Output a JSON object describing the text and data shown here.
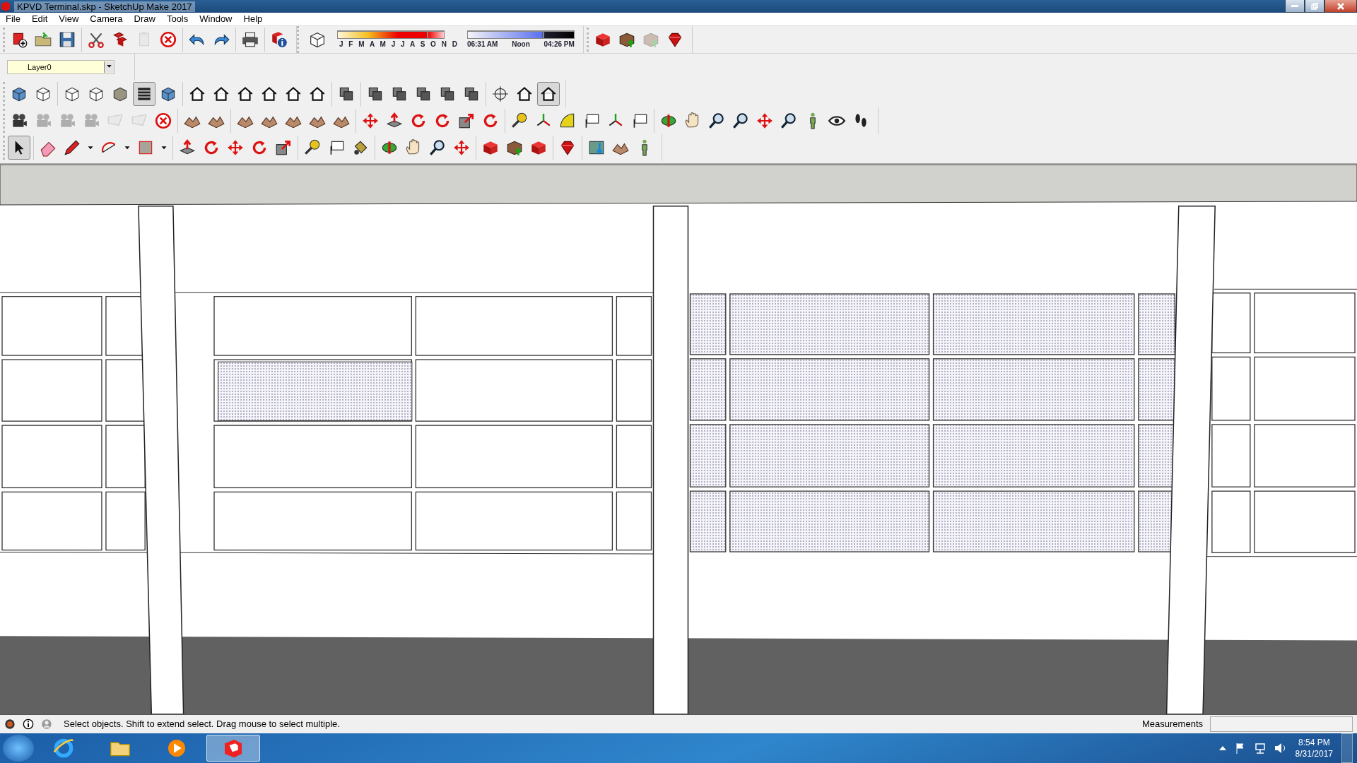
{
  "window": {
    "title": "KPVD Terminal.skp - SketchUp Make 2017"
  },
  "menu": [
    "File",
    "Edit",
    "View",
    "Camera",
    "Draw",
    "Tools",
    "Window",
    "Help"
  ],
  "standard_toolbar": [
    [
      {
        "kind": "new",
        "selected": false,
        "disabled": false
      },
      {
        "kind": "open",
        "selected": false,
        "disabled": false
      },
      {
        "kind": "save",
        "selected": false,
        "disabled": false
      }
    ],
    [
      {
        "kind": "cut",
        "selected": false,
        "disabled": false
      },
      {
        "kind": "copy",
        "selected": false,
        "disabled": false
      },
      {
        "kind": "paste",
        "selected": false,
        "disabled": true
      },
      {
        "kind": "delete",
        "selected": false,
        "disabled": false
      }
    ],
    [
      {
        "kind": "undo",
        "selected": false,
        "disabled": false
      },
      {
        "kind": "redo",
        "selected": false,
        "disabled": false
      }
    ],
    [
      {
        "kind": "print",
        "selected": false,
        "disabled": false
      }
    ],
    [
      {
        "kind": "info",
        "selected": false,
        "disabled": false
      }
    ]
  ],
  "shadow_settings": {
    "months": "J F M A M J J A S O N D",
    "date_slider": {
      "level": 0.85
    },
    "time_slider": {
      "level": 0.72
    },
    "start_time": "06:31 AM",
    "noon": "Noon",
    "end_time": "04:26 PM"
  },
  "warehouse_toolbar": [
    [
      {
        "kind": "warehouse",
        "selected": false,
        "disabled": false
      },
      {
        "kind": "share",
        "selected": false,
        "disabled": false
      },
      {
        "kind": "share",
        "selected": false,
        "disabled": true
      },
      {
        "kind": "gem",
        "selected": false,
        "disabled": false
      }
    ]
  ],
  "layer": {
    "value": "Layer0"
  },
  "toolbar_rows": [
    [
      [
        {
          "kind": "cube",
          "selected": false,
          "disabled": false
        },
        {
          "kind": "cube-outline",
          "selected": false,
          "disabled": false
        }
      ],
      [
        {
          "kind": "cube-outline",
          "selected": false,
          "disabled": false
        },
        {
          "kind": "cube-outline",
          "selected": false,
          "disabled": false
        },
        {
          "kind": "cube-gray",
          "selected": false,
          "disabled": false
        },
        {
          "kind": "stripes",
          "selected": true,
          "disabled": false
        },
        {
          "kind": "cube",
          "selected": false,
          "disabled": false
        }
      ],
      [
        {
          "kind": "house",
          "selected": false,
          "disabled": false
        },
        {
          "kind": "house",
          "selected": false,
          "disabled": false
        },
        {
          "kind": "house",
          "selected": false,
          "disabled": false
        },
        {
          "kind": "house",
          "selected": false,
          "disabled": false
        },
        {
          "kind": "house",
          "selected": false,
          "disabled": false
        },
        {
          "kind": "house",
          "selected": false,
          "disabled": false
        }
      ],
      [
        {
          "kind": "boxes",
          "selected": false,
          "disabled": false
        }
      ],
      [
        {
          "kind": "boxes",
          "selected": false,
          "disabled": false
        },
        {
          "kind": "boxes",
          "selected": false,
          "disabled": false
        },
        {
          "kind": "boxes",
          "selected": false,
          "disabled": false
        },
        {
          "kind": "boxes",
          "selected": false,
          "disabled": false
        },
        {
          "kind": "boxes",
          "selected": false,
          "disabled": false
        }
      ],
      [
        {
          "kind": "compass",
          "selected": false,
          "disabled": false
        },
        {
          "kind": "house",
          "selected": false,
          "disabled": false
        },
        {
          "kind": "house",
          "selected": true,
          "disabled": false
        }
      ]
    ],
    [
      [
        {
          "kind": "camera",
          "selected": false,
          "disabled": false
        },
        {
          "kind": "camera",
          "selected": false,
          "disabled": true
        },
        {
          "kind": "camera",
          "selected": false,
          "disabled": true
        },
        {
          "kind": "camera",
          "selected": false,
          "disabled": true
        },
        {
          "kind": "plane",
          "selected": false,
          "disabled": true
        },
        {
          "kind": "plane",
          "selected": false,
          "disabled": true
        },
        {
          "kind": "delete",
          "selected": false,
          "disabled": false
        }
      ],
      [
        {
          "kind": "terrain",
          "selected": false,
          "disabled": false
        },
        {
          "kind": "terrain",
          "selected": false,
          "disabled": false
        }
      ],
      [
        {
          "kind": "terrain",
          "selected": false,
          "disabled": false
        },
        {
          "kind": "terrain",
          "selected": false,
          "disabled": false
        },
        {
          "kind": "terrain",
          "selected": false,
          "disabled": false
        },
        {
          "kind": "terrain",
          "selected": false,
          "disabled": false
        },
        {
          "kind": "terrain",
          "selected": false,
          "disabled": false
        }
      ],
      [
        {
          "kind": "move",
          "selected": false,
          "disabled": false
        },
        {
          "kind": "pushpull",
          "selected": false,
          "disabled": false
        },
        {
          "kind": "rotate",
          "selected": false,
          "disabled": false
        },
        {
          "kind": "rotate",
          "selected": false,
          "disabled": false
        },
        {
          "kind": "scale",
          "selected": false,
          "disabled": false
        },
        {
          "kind": "rotate",
          "selected": false,
          "disabled": false
        }
      ],
      [
        {
          "kind": "tape",
          "selected": false,
          "disabled": false
        },
        {
          "kind": "axes",
          "selected": false,
          "disabled": false
        },
        {
          "kind": "protractor",
          "selected": false,
          "disabled": false
        },
        {
          "kind": "tag",
          "selected": false,
          "disabled": false
        },
        {
          "kind": "axes",
          "selected": false,
          "disabled": false
        },
        {
          "kind": "tag",
          "selected": false,
          "disabled": false
        }
      ],
      [
        {
          "kind": "orbit",
          "selected": false,
          "disabled": false
        },
        {
          "kind": "pan",
          "selected": false,
          "disabled": false
        },
        {
          "kind": "zoom",
          "selected": false,
          "disabled": false
        },
        {
          "kind": "zoom",
          "selected": false,
          "disabled": false
        },
        {
          "kind": "move",
          "selected": false,
          "disabled": false
        },
        {
          "kind": "zoom",
          "selected": false,
          "disabled": false
        },
        {
          "kind": "figure",
          "selected": false,
          "disabled": false
        },
        {
          "kind": "eye",
          "selected": false,
          "disabled": false
        },
        {
          "kind": "feet",
          "selected": false,
          "disabled": false
        }
      ]
    ],
    [
      [
        {
          "kind": "select",
          "selected": true,
          "disabled": false
        }
      ],
      [
        {
          "kind": "eraser",
          "selected": false,
          "disabled": false
        },
        {
          "kind": "pencil",
          "selected": false,
          "disabled": false
        },
        {
          "kind": "caret",
          "selected": false,
          "disabled": false
        },
        {
          "kind": "arc",
          "selected": false,
          "disabled": false
        },
        {
          "kind": "caret",
          "selected": false,
          "disabled": false
        },
        {
          "kind": "rectangle",
          "selected": false,
          "disabled": false
        },
        {
          "kind": "caret",
          "selected": false,
          "disabled": false
        }
      ],
      [
        {
          "kind": "pushpull",
          "selected": false,
          "disabled": false
        },
        {
          "kind": "rotate",
          "selected": false,
          "disabled": false
        },
        {
          "kind": "move",
          "selected": false,
          "disabled": false
        },
        {
          "kind": "rotate",
          "selected": false,
          "disabled": false
        },
        {
          "kind": "scale",
          "selected": false,
          "disabled": false
        }
      ],
      [
        {
          "kind": "tape",
          "selected": false,
          "disabled": false
        },
        {
          "kind": "tag",
          "selected": false,
          "disabled": false
        },
        {
          "kind": "paint",
          "selected": false,
          "disabled": false
        }
      ],
      [
        {
          "kind": "orbit",
          "selected": false,
          "disabled": false
        },
        {
          "kind": "pan",
          "selected": false,
          "disabled": false
        },
        {
          "kind": "zoom",
          "selected": false,
          "disabled": false
        },
        {
          "kind": "move",
          "selected": false,
          "disabled": false
        }
      ],
      [
        {
          "kind": "warehouse",
          "selected": false,
          "disabled": false
        },
        {
          "kind": "share",
          "selected": false,
          "disabled": false
        },
        {
          "kind": "warehouse",
          "selected": false,
          "disabled": false
        }
      ],
      [
        {
          "kind": "gem",
          "selected": false,
          "disabled": false
        }
      ],
      [
        {
          "kind": "map",
          "selected": false,
          "disabled": false
        },
        {
          "kind": "terrain",
          "selected": false,
          "disabled": false
        },
        {
          "kind": "figure",
          "selected": false,
          "disabled": false
        }
      ]
    ]
  ],
  "status_bar": {
    "message": "Select objects. Shift to extend select. Drag mouse to select multiple.",
    "measurements_label": "Measurements"
  },
  "taskbar": {
    "apps": [
      {
        "kind": "browser",
        "selected": false
      },
      {
        "kind": "folder",
        "selected": false
      },
      {
        "kind": "player",
        "selected": false
      },
      {
        "kind": "sketchup",
        "selected": true
      }
    ],
    "time": "8:54 PM",
    "date": "8/31/2017"
  }
}
